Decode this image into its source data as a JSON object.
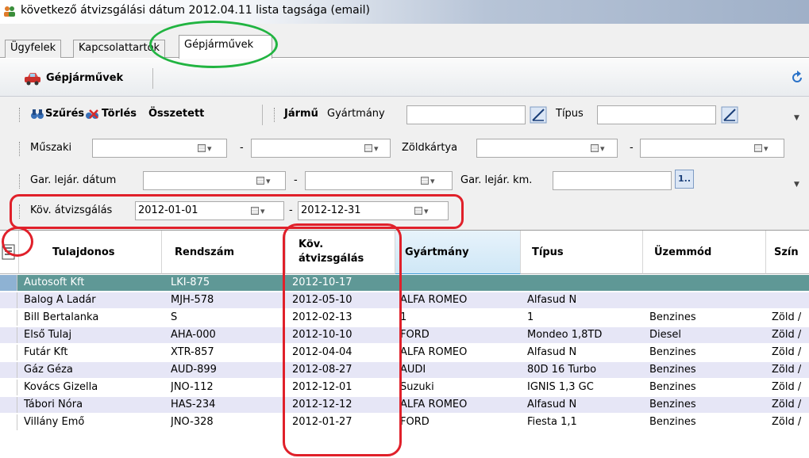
{
  "window": {
    "title": "következő átvizsgálási dátum 2012.04.11 lista tagsága (email)",
    "icon": "people-icon"
  },
  "tabs": [
    {
      "label": "Ügyfelek",
      "active": false
    },
    {
      "label": "Kapcsolattartók",
      "active": false
    },
    {
      "label": "Gépjárművek",
      "active": true
    }
  ],
  "toolbar": {
    "title": "Gépjárművek",
    "icon": "car-icon",
    "refresh_icon": "refresh-icon"
  },
  "filters": {
    "filter_btn": "Szűrés",
    "clear_btn": "Törlés",
    "combined_btn": "Összetett",
    "vehicle_label": "Jármű",
    "manufacturer_label": "Gyártmány",
    "manufacturer_value": "",
    "type_label": "Típus",
    "type_value": "",
    "technical_label": "Műszaki",
    "technical_from": "",
    "technical_to": "",
    "greencard_label": "Zöldkártya",
    "greencard_from": "",
    "greencard_to": "",
    "warranty_date_label": "Gar. lejár. dátum",
    "warranty_from": "",
    "warranty_to": "",
    "warranty_km_label": "Gar. lejár. km.",
    "warranty_km_value": "",
    "warranty_km_btn": "1..",
    "next_inspection_label": "Köv. átvizsgálás",
    "next_inspection_from": "2012-01-01",
    "next_inspection_to": "2012-12-31",
    "dash": "-"
  },
  "grid": {
    "columns": [
      "Tulajdonos",
      "Rendszám",
      "Köv.",
      "átvizsgálás",
      "Gyártmány",
      "Típus",
      "Üzemmód",
      "Szín"
    ],
    "rows": [
      [
        "Autosoft Kft",
        "LKI-875",
        "2012-10-17",
        "",
        "",
        "",
        ""
      ],
      [
        "Balog A Ladár",
        "MJH-578",
        "2012-05-10",
        "ALFA ROMEO",
        "Alfasud N",
        "",
        ""
      ],
      [
        "Bill Bertalanka",
        "S",
        "2012-02-13",
        "1",
        "1",
        "Benzines",
        "Zöld /"
      ],
      [
        "Első Tulaj",
        "AHA-000",
        "2012-10-10",
        "FORD",
        "Mondeo 1,8TD",
        "Diesel",
        "Zöld /"
      ],
      [
        "Futár Kft",
        "XTR-857",
        "2012-04-04",
        "ALFA ROMEO",
        "Alfasud N",
        "Benzines",
        "Zöld /"
      ],
      [
        "Gáz Géza",
        "AUD-899",
        "2012-08-27",
        "AUDI",
        "80D 16 Turbo",
        "Benzines",
        "Zöld /"
      ],
      [
        "Kovács Gizella",
        "JNO-112",
        "2012-12-01",
        "Suzuki",
        "IGNIS 1,3 GC",
        "Benzines",
        "Zöld /"
      ],
      [
        "Tábori Nóra",
        "HAS-234",
        "2012-12-12",
        "ALFA ROMEO",
        "Alfasud N",
        "Benzines",
        "Zöld /"
      ],
      [
        "Villány Emő",
        "JNO-328",
        "2012-01-27",
        "FORD",
        "Fiesta 1,1",
        "Benzines",
        "Zöld /"
      ]
    ]
  },
  "colors": {
    "selected_row": "#5f9896",
    "alt_row": "#e6e6f6",
    "annotation_red": "#e0202a",
    "annotation_green": "#21b441"
  }
}
